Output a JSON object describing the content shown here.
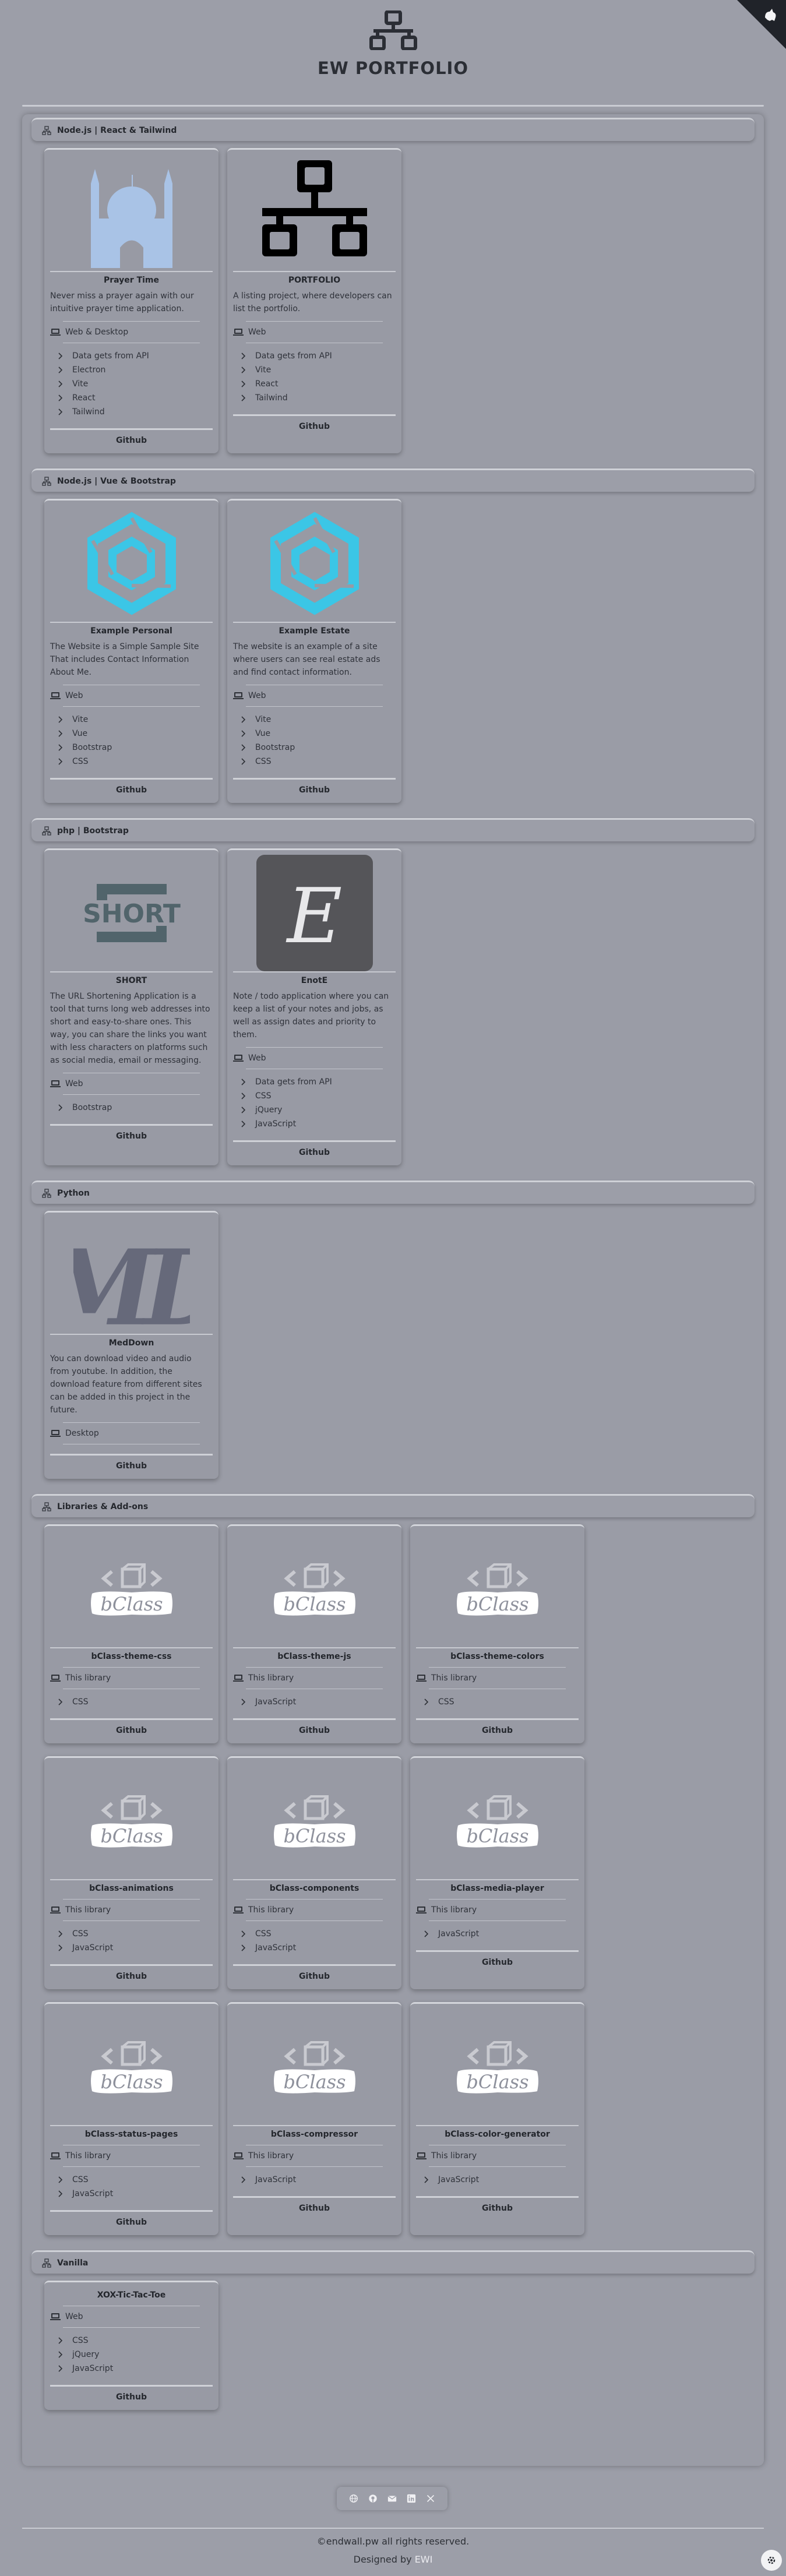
{
  "site": {
    "title": "EW PORTFOLIO"
  },
  "sections": [
    {
      "title": "Node.js | React & Tailwind",
      "cards": [
        {
          "image": "mosque",
          "title": "Prayer Time",
          "desc": "Never miss a prayer again with our intuitive prayer time application.",
          "platform": "Web & Desktop",
          "tech": [
            "Data gets from API",
            "Electron",
            "Vite",
            "React",
            "Tailwind"
          ],
          "button": "Github"
        },
        {
          "image": "network",
          "title": "PORTFOLIO",
          "desc": "A listing project, where developers can list the portfolio.",
          "platform": "Web",
          "tech": [
            "Data gets from API",
            "Vite",
            "React",
            "Tailwind"
          ],
          "button": "Github"
        }
      ]
    },
    {
      "title": "Node.js | Vue & Bootstrap",
      "cards": [
        {
          "image": "hexagon",
          "title": "Example Personal",
          "desc": "The Website is a Simple Sample Site That includes Contact Information About Me.",
          "platform": "Web",
          "tech": [
            "Vite",
            "Vue",
            "Bootstrap",
            "CSS"
          ],
          "button": "Github"
        },
        {
          "image": "hexagon",
          "title": "Example Estate",
          "desc": "The website is an example of a site where users can see real estate ads and find contact information.",
          "platform": "Web",
          "tech": [
            "Vite",
            "Vue",
            "Bootstrap",
            "CSS"
          ],
          "button": "Github"
        }
      ]
    },
    {
      "title": "php | Bootstrap",
      "cards": [
        {
          "image": "short",
          "logo_text": "SHORT",
          "title": "SHORT",
          "desc": "The URL Shortening Application is a tool that turns long web addresses into short and easy-to-share ones. This way, you can share the links you want with less characters on platforms such as social media, email or messaging.",
          "platform": "Web",
          "tech": [
            "Bootstrap"
          ],
          "button": "Github"
        },
        {
          "image": "enote",
          "logo_text": "E",
          "title": "EnotE",
          "desc": "Note / todo application where you can keep a list of your notes and jobs, as well as assign dates and priority to them.",
          "platform": "Web",
          "tech": [
            "Data gets from API",
            "CSS",
            "jQuery",
            "JavaScript"
          ],
          "button": "Github"
        }
      ]
    },
    {
      "title": "Python",
      "cards": [
        {
          "image": "md",
          "logo_text": "MD",
          "title": "MedDown",
          "desc": "You can download video and audio from youtube. In addition, the download feature from different sites can be added in this project in the future.",
          "platform": "Desktop",
          "tech": [],
          "button": "Github"
        }
      ]
    },
    {
      "title": "Libraries & Add-ons",
      "cards": [
        {
          "image": "bclass",
          "logo_text": "bClass",
          "title": "bClass-theme-css",
          "desc": "",
          "platform": "This library",
          "tech": [
            "CSS"
          ],
          "button": "Github"
        },
        {
          "image": "bclass",
          "logo_text": "bClass",
          "title": "bClass-theme-js",
          "desc": "",
          "platform": "This library",
          "tech": [
            "JavaScript"
          ],
          "button": "Github"
        },
        {
          "image": "bclass",
          "logo_text": "bClass",
          "title": "bClass-theme-colors",
          "desc": "",
          "platform": "This library",
          "tech": [
            "CSS"
          ],
          "button": "Github"
        },
        {
          "image": "bclass",
          "logo_text": "bClass",
          "title": "bClass-animations",
          "desc": "",
          "platform": "This library",
          "tech": [
            "CSS",
            "JavaScript"
          ],
          "button": "Github"
        },
        {
          "image": "bclass",
          "logo_text": "bClass",
          "title": "bClass-components",
          "desc": "",
          "platform": "This library",
          "tech": [
            "CSS",
            "JavaScript"
          ],
          "button": "Github"
        },
        {
          "image": "bclass",
          "logo_text": "bClass",
          "title": "bClass-media-player",
          "desc": "",
          "platform": "This library",
          "tech": [
            "JavaScript"
          ],
          "button": "Github"
        },
        {
          "image": "bclass",
          "logo_text": "bClass",
          "title": "bClass-status-pages",
          "desc": "",
          "platform": "This library",
          "tech": [
            "CSS",
            "JavaScript"
          ],
          "button": "Github"
        },
        {
          "image": "bclass",
          "logo_text": "bClass",
          "title": "bClass-compressor",
          "desc": "",
          "platform": "This library",
          "tech": [
            "JavaScript"
          ],
          "button": "Github"
        },
        {
          "image": "bclass",
          "logo_text": "bClass",
          "title": "bClass-color-generator",
          "desc": "",
          "platform": "This library",
          "tech": [
            "JavaScript"
          ],
          "button": "Github"
        }
      ]
    },
    {
      "title": "Vanilla",
      "cards": [
        {
          "image": "none",
          "title": "XOX-Tic-Tac-Toe",
          "desc": "",
          "platform": "Web",
          "tech": [
            "CSS",
            "jQuery",
            "JavaScript"
          ],
          "button": "Github"
        }
      ]
    }
  ],
  "footer": {
    "social_icons": [
      "globe-icon",
      "github-icon",
      "mail-icon",
      "linkedin-icon",
      "x-icon"
    ],
    "copyright": "©endwall.pw all rights reserved.",
    "designed_by": "Designed by",
    "designer": "EWI"
  },
  "colors": {
    "background": "#9c9ea8",
    "mosque": "#a9c3e6",
    "hexagon": "#3bc6e6",
    "bclass_icon": "#c9cad0"
  }
}
